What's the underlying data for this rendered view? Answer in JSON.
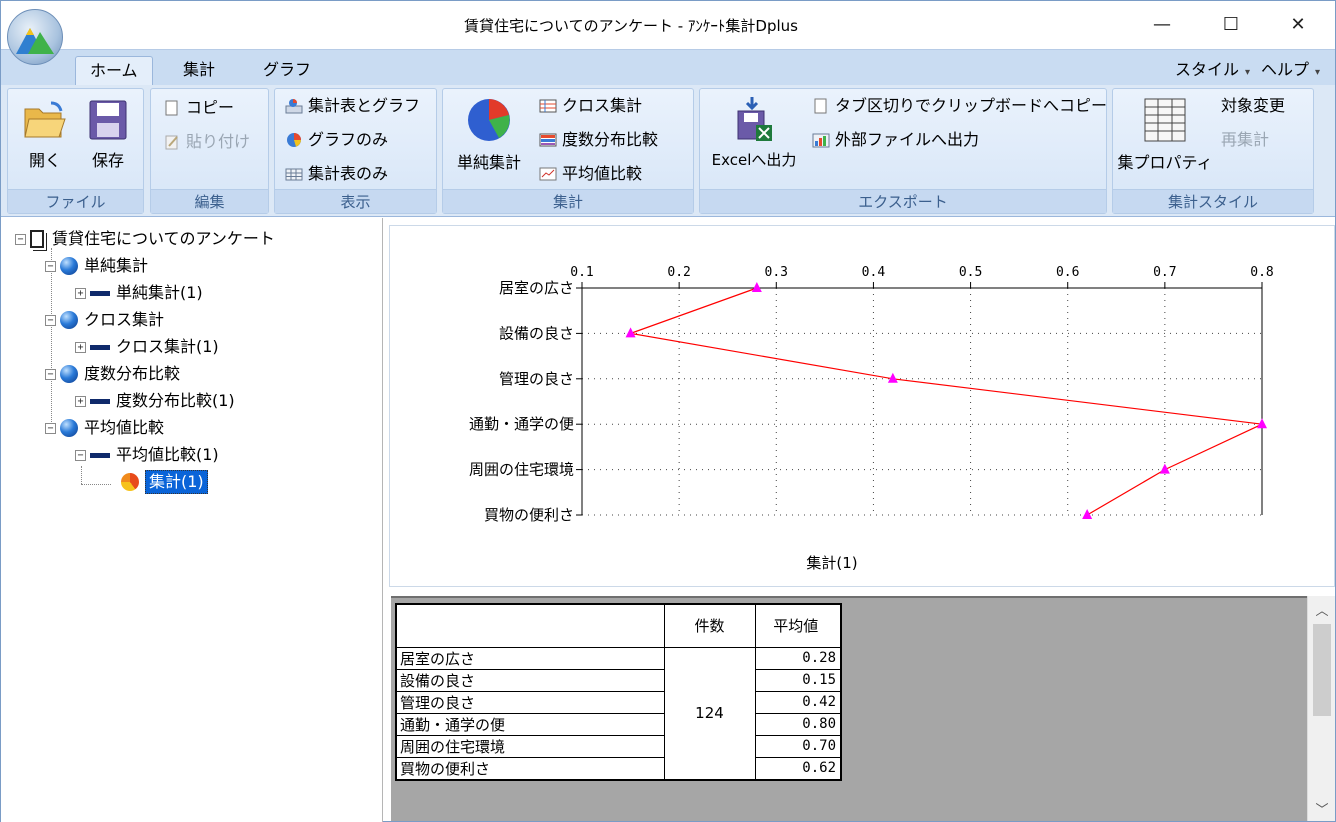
{
  "window": {
    "title": "賃貸住宅についてのアンケート - ｱﾝｹｰﾄ集計Dplus",
    "minimize": "—",
    "maximize": "☐",
    "close": "✕"
  },
  "ribbon": {
    "tabs": {
      "home": "ホーム",
      "aggregate": "集計",
      "graph": "グラフ",
      "style": "スタイル",
      "help": "ヘルプ"
    },
    "groups": {
      "file": {
        "label": "ファイル",
        "open": "開く",
        "save": "保存"
      },
      "edit": {
        "label": "編集",
        "copy": "コピー",
        "paste": "貼り付け"
      },
      "view": {
        "label": "表示",
        "table_and_graph": "集計表とグラフ",
        "graph_only": "グラフのみ",
        "table_only": "集計表のみ"
      },
      "aggregate": {
        "label": "集計",
        "simple": "単純集計",
        "cross": "クロス集計",
        "freq_compare": "度数分布比較",
        "mean_compare": "平均値比較"
      },
      "export": {
        "label": "エクスポート",
        "excel": "Excelへ出力",
        "tab_clipboard": "タブ区切りでクリップボードへコピー",
        "external_file": "外部ファイルへ出力"
      },
      "agg_style": {
        "label": "集計スタイル",
        "properties": "集プロパティ",
        "change_target": "対象変更",
        "recalc": "再集計"
      }
    }
  },
  "tree": {
    "root": "賃貸住宅についてのアンケート",
    "nodes": [
      {
        "label": "単純集計",
        "child": "単純集計(1)"
      },
      {
        "label": "クロス集計",
        "child": "クロス集計(1)"
      },
      {
        "label": "度数分布比較",
        "child": "度数分布比較(1)"
      },
      {
        "label": "平均値比較",
        "child": "平均値比較(1)"
      }
    ],
    "selected_leaf": "集計(1)"
  },
  "chart_data": {
    "type": "line",
    "orientation": "horizontal",
    "categories": [
      "居室の広さ",
      "設備の良さ",
      "管理の良さ",
      "通勤・通学の便",
      "周囲の住宅環境",
      "買物の便利さ"
    ],
    "series": [
      {
        "values": [
          0.28,
          0.15,
          0.42,
          0.8,
          0.7,
          0.62
        ],
        "color": "#ff0000",
        "marker_color": "#ff00ff"
      }
    ],
    "xlim": [
      0.1,
      0.8
    ],
    "xticks": [
      "0.1",
      "0.2",
      "0.3",
      "0.4",
      "0.5",
      "0.6",
      "0.7",
      "0.8"
    ],
    "xlabel": "集計(1)",
    "grid": true
  },
  "table": {
    "headers": {
      "count": "件数",
      "mean": "平均値"
    },
    "rows": [
      {
        "label": "居室の広さ",
        "mean": "0.28"
      },
      {
        "label": "設備の良さ",
        "mean": "0.15"
      },
      {
        "label": "管理の良さ",
        "mean": "0.42"
      },
      {
        "label": "通勤・通学の便",
        "mean": "0.80"
      },
      {
        "label": "周囲の住宅環境",
        "mean": "0.70"
      },
      {
        "label": "買物の便利さ",
        "mean": "0.62"
      }
    ],
    "count": "124"
  },
  "scrollbar": {
    "up": "︿",
    "down": "﹀"
  }
}
